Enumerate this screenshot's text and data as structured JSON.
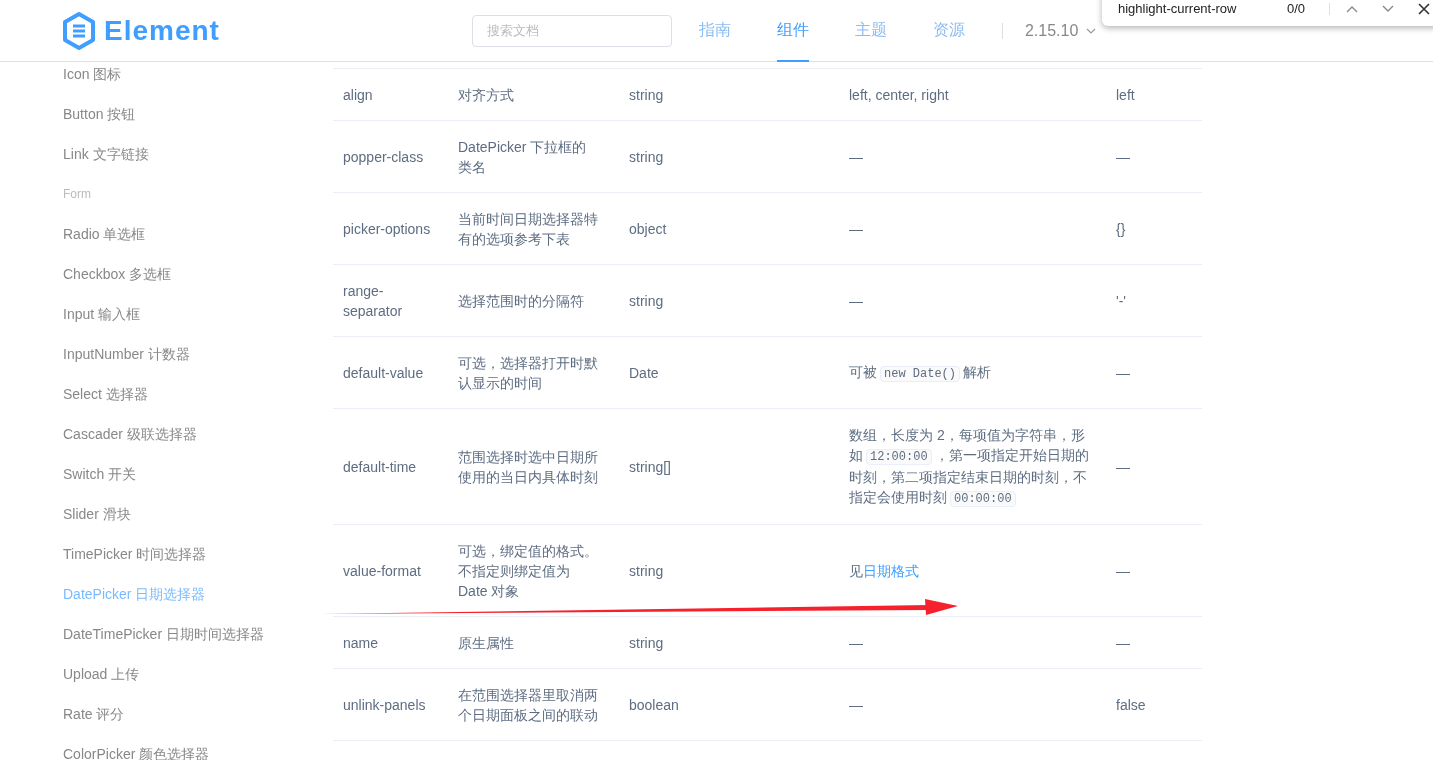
{
  "header": {
    "logo_text": "Element",
    "search": {
      "placeholder": "搜索文档"
    },
    "nav": [
      {
        "label": "指南",
        "selected": false
      },
      {
        "label": "组件",
        "selected": true
      },
      {
        "label": "主题",
        "selected": false
      },
      {
        "label": "资源",
        "selected": false
      }
    ],
    "version": "2.15.10"
  },
  "find_bar": {
    "query": "highlight-current-row",
    "count": "0/0"
  },
  "sidebar": {
    "items": [
      {
        "kind": "item",
        "label": "Icon 图标",
        "selected": false
      },
      {
        "kind": "item",
        "label": "Button 按钮",
        "selected": false
      },
      {
        "kind": "item",
        "label": "Link 文字链接",
        "selected": false
      },
      {
        "kind": "group",
        "label": "Form"
      },
      {
        "kind": "item",
        "label": "Radio 单选框",
        "selected": false
      },
      {
        "kind": "item",
        "label": "Checkbox 多选框",
        "selected": false
      },
      {
        "kind": "item",
        "label": "Input 输入框",
        "selected": false
      },
      {
        "kind": "item",
        "label": "InputNumber 计数器",
        "selected": false
      },
      {
        "kind": "item",
        "label": "Select 选择器",
        "selected": false
      },
      {
        "kind": "item",
        "label": "Cascader 级联选择器",
        "selected": false
      },
      {
        "kind": "item",
        "label": "Switch 开关",
        "selected": false
      },
      {
        "kind": "item",
        "label": "Slider 滑块",
        "selected": false
      },
      {
        "kind": "item",
        "label": "TimePicker 时间选择器",
        "selected": false
      },
      {
        "kind": "item",
        "label": "DatePicker 日期选择器",
        "selected": true
      },
      {
        "kind": "item",
        "label": "DateTimePicker 日期时间选择器",
        "selected": false
      },
      {
        "kind": "item",
        "label": "Upload 上传",
        "selected": false
      },
      {
        "kind": "item",
        "label": "Rate 评分",
        "selected": false
      },
      {
        "kind": "item",
        "label": "ColorPicker 颜色选择器",
        "selected": false
      }
    ]
  },
  "table": {
    "rows": [
      {
        "param": "align",
        "description": "对齐方式",
        "type": "string",
        "options": [
          {
            "kind": "text",
            "text": "left, center, right"
          }
        ],
        "default": "left"
      },
      {
        "param": "popper-class",
        "description": "DatePicker 下拉框的类名",
        "type": "string",
        "options": [
          {
            "kind": "text",
            "text": "—"
          }
        ],
        "default": "—"
      },
      {
        "param": "picker-options",
        "description": "当前时间日期选择器特有的选项参考下表",
        "type": "object",
        "options": [
          {
            "kind": "text",
            "text": "—"
          }
        ],
        "default": "{}"
      },
      {
        "param": "range-separator",
        "description": "选择范围时的分隔符",
        "type": "string",
        "options": [
          {
            "kind": "text",
            "text": "—"
          }
        ],
        "default": "'-'"
      },
      {
        "param": "default-value",
        "description": "可选，选择器打开时默认显示的时间",
        "type": "Date",
        "options": [
          {
            "kind": "text",
            "text": "可被"
          },
          {
            "kind": "code",
            "text": "new Date()"
          },
          {
            "kind": "text",
            "text": "解析"
          }
        ],
        "default": "—"
      },
      {
        "param": "default-time",
        "description": "范围选择时选中日期所使用的当日内具体时刻",
        "type": "string[]",
        "options": [
          {
            "kind": "text",
            "text": "数组，长度为 2，每项值为字符串，形如"
          },
          {
            "kind": "code",
            "text": "12:00:00"
          },
          {
            "kind": "text",
            "text": "，第一项指定开始日期的时刻，第二项指定结束日期的时刻，不指定会使用时刻"
          },
          {
            "kind": "code",
            "text": "00:00:00"
          }
        ],
        "default": "—"
      },
      {
        "param": "value-format",
        "description": "可选，绑定值的格式。不指定则绑定值为 Date 对象",
        "type": "string",
        "options": [
          {
            "kind": "text",
            "text": "见"
          },
          {
            "kind": "link",
            "text": "日期格式"
          }
        ],
        "default": "—"
      },
      {
        "param": "name",
        "description": "原生属性",
        "type": "string",
        "options": [
          {
            "kind": "text",
            "text": "—"
          }
        ],
        "default": "—"
      },
      {
        "param": "unlink-panels",
        "description": "在范围选择器里取消两个日期面板之间的联动",
        "type": "boolean",
        "options": [
          {
            "kind": "text",
            "text": "—"
          }
        ],
        "default": "false"
      }
    ]
  }
}
